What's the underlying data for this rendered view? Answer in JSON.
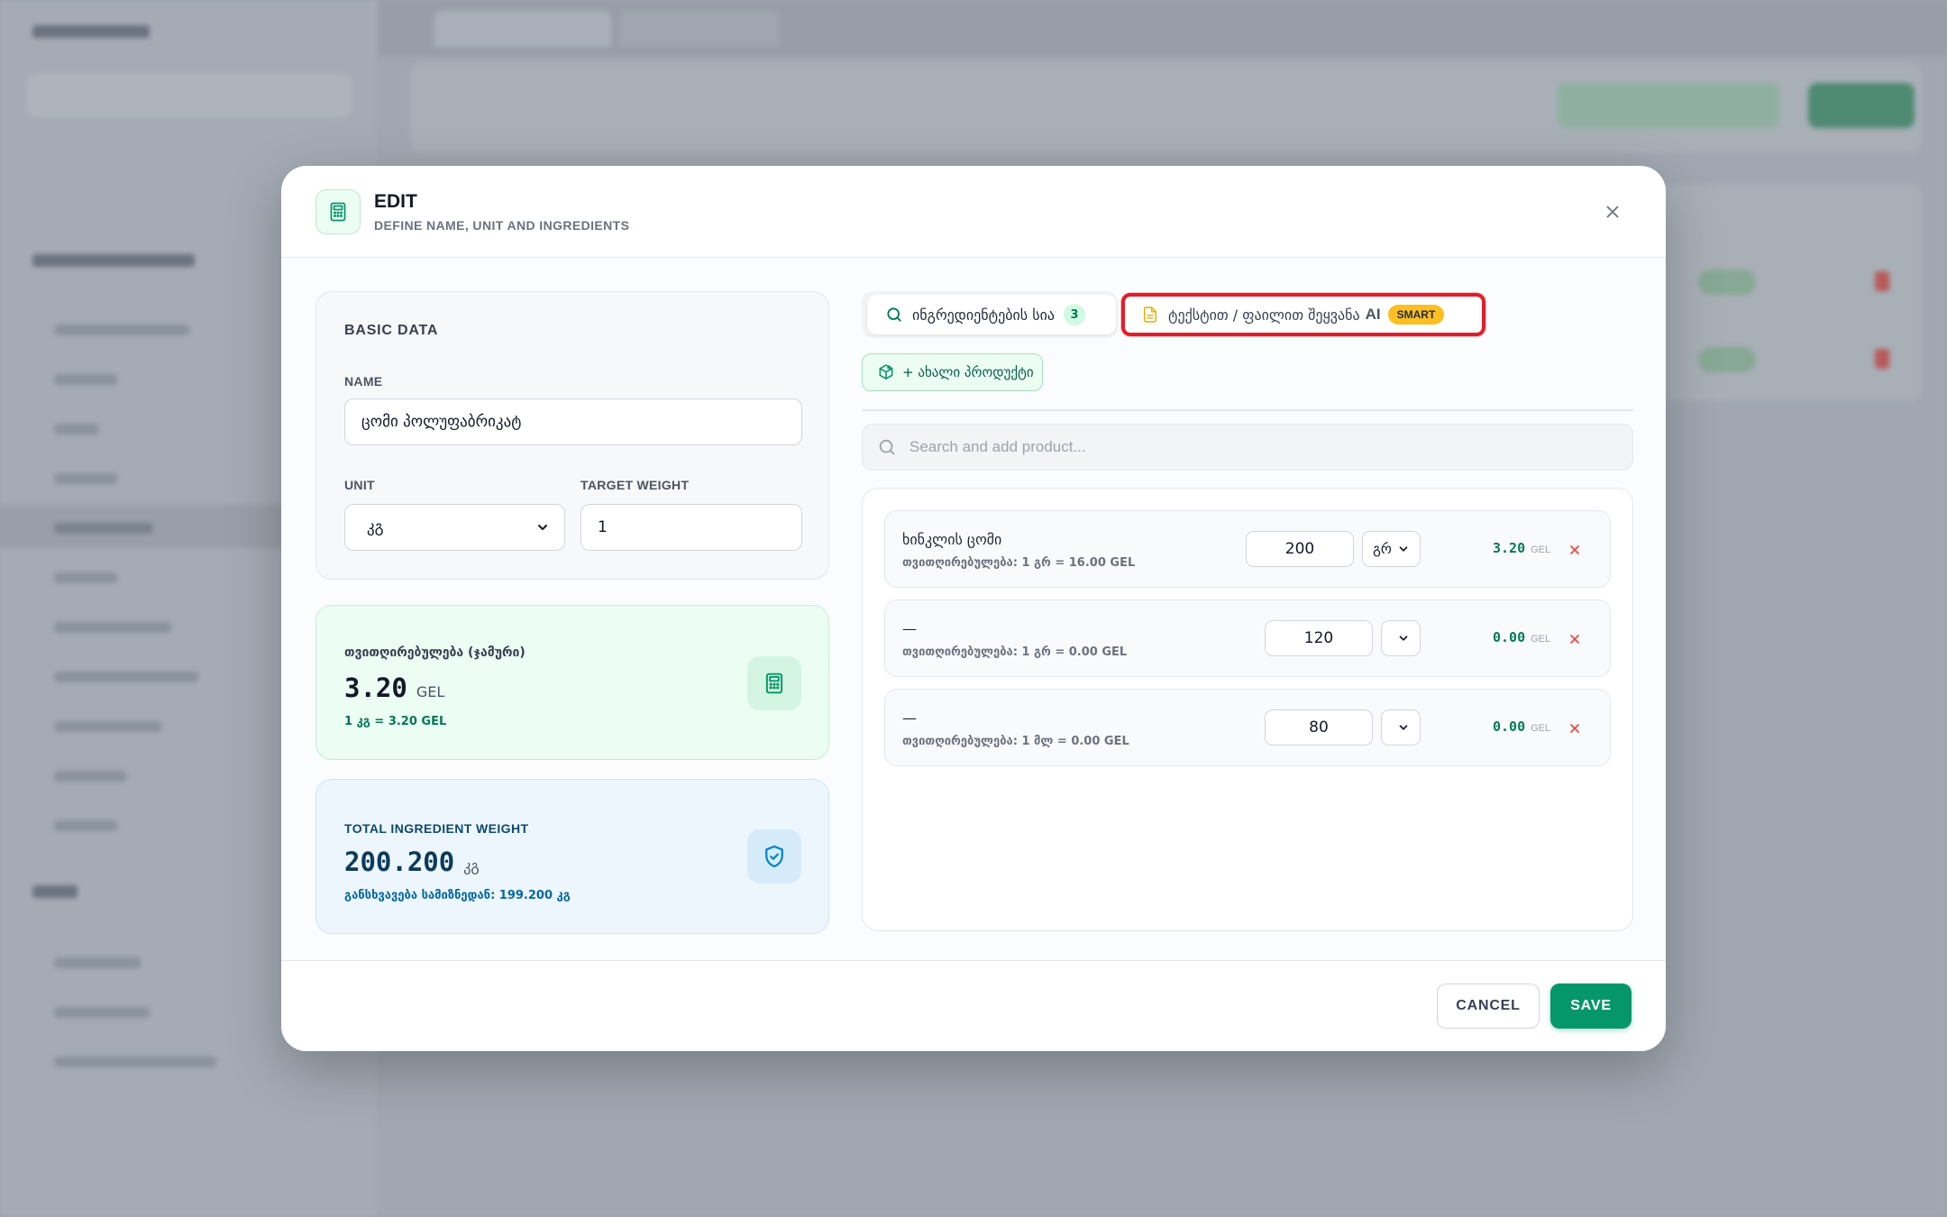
{
  "colors": {
    "accent": "#059669",
    "highlight": "#e11d2c",
    "smart_badge": "#fbbf24"
  },
  "modal": {
    "title": "EDIT",
    "subtitle": "DEFINE NAME, UNIT AND INGREDIENTS",
    "header_icon": "calculator-icon",
    "close_icon": "close-icon"
  },
  "basic": {
    "section_title": "BASIC DATA",
    "name_label": "NAME",
    "name_value": "ცომი პოლუფაბრიკატ",
    "unit_label": "UNIT",
    "unit_value": "კგ",
    "target_label": "TARGET WEIGHT",
    "target_value": "1"
  },
  "cost": {
    "label": "თვითღირებულება (ჯამური)",
    "value": "3.20",
    "currency": "GEL",
    "note": "1 კგ = 3.20 GEL",
    "icon": "calculator-icon"
  },
  "weight": {
    "label": "TOTAL INGREDIENT WEIGHT",
    "value": "200.200",
    "unit": "კგ",
    "note": "განსხვავება სამიზნედან: 199.200 კგ",
    "icon": "shield-check-icon"
  },
  "tabs": {
    "list_label": "ინგრედიენტების სია",
    "list_count": "3",
    "ai_label": "ტექსტით / ფაილით შეყვანა",
    "ai_tag": "AI",
    "ai_badge": "SMART"
  },
  "new_product_label": "+ ახალი პროდუქტი",
  "search": {
    "placeholder": "Search and add product..."
  },
  "ingredients": [
    {
      "name": "ხინკლის ცომი",
      "cost_line": "თვითღირებულება: 1 გრ = 16.00 GEL",
      "qty": "200",
      "unit": "გრ",
      "price": "3.20",
      "currency": "GEL"
    },
    {
      "name": "—",
      "cost_line": "თვითღირებულება: 1 გრ = 0.00 GEL",
      "qty": "120",
      "unit": "",
      "price": "0.00",
      "currency": "GEL"
    },
    {
      "name": "—",
      "cost_line": "თვითღირებულება: 1 მლ = 0.00 GEL",
      "qty": "80",
      "unit": "",
      "price": "0.00",
      "currency": "GEL"
    }
  ],
  "footer": {
    "cancel": "CANCEL",
    "save": "SAVE"
  }
}
